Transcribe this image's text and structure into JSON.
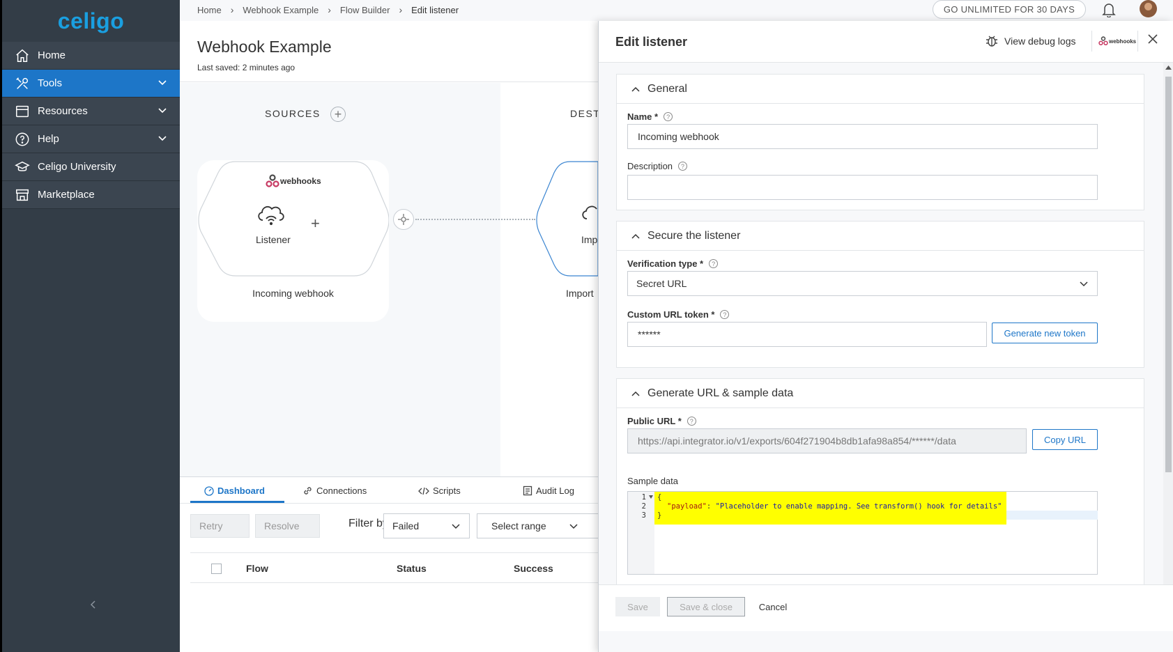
{
  "app": {
    "logo_text": "celigo"
  },
  "sidebar": {
    "items": [
      {
        "label": "Home",
        "icon": "home-icon",
        "active": false,
        "expandable": false
      },
      {
        "label": "Tools",
        "icon": "tools-icon",
        "active": true,
        "expandable": true
      },
      {
        "label": "Resources",
        "icon": "resources-icon",
        "active": false,
        "expandable": true
      },
      {
        "label": "Help",
        "icon": "help-icon",
        "active": false,
        "expandable": true
      },
      {
        "label": "Celigo University",
        "icon": "university-icon",
        "active": false,
        "expandable": false
      },
      {
        "label": "Marketplace",
        "icon": "marketplace-icon",
        "active": false,
        "expandable": false
      }
    ]
  },
  "topbar": {
    "breadcrumb": [
      "Home",
      "Webhook Example",
      "Flow Builder",
      "Edit listener"
    ],
    "promo_label": "GO UNLIMITED FOR 30 DAYS"
  },
  "flow": {
    "title": "Webhook Example",
    "last_saved": "Last saved: 2 minutes ago",
    "sources_label": "SOURCES",
    "destinations_label": "DEST",
    "source": {
      "brand": "webhooks",
      "type_label": "Listener",
      "name": "Incoming webhook"
    },
    "destination": {
      "type_label_partial": "Imp",
      "name_partial": "Import"
    }
  },
  "dashboard": {
    "tabs": [
      "Dashboard",
      "Connections",
      "Scripts",
      "Audit Log"
    ],
    "retry_label": "Retry",
    "resolve_label": "Resolve",
    "filter_label": "Filter by:",
    "filter_value": "Failed",
    "range_label": "Select range",
    "columns": [
      "Flow",
      "Status",
      "Success"
    ]
  },
  "drawer": {
    "title": "Edit listener",
    "debug_logs_label": "View debug logs",
    "brand_small": "webhooks",
    "general": {
      "title": "General",
      "name_label": "Name *",
      "name_value": "Incoming webhook",
      "description_label": "Description",
      "description_value": ""
    },
    "secure": {
      "title": "Secure the listener",
      "verification_label": "Verification type *",
      "verification_value": "Secret URL",
      "token_label": "Custom URL token *",
      "token_value": "******",
      "generate_label": "Generate new token"
    },
    "generate": {
      "title": "Generate URL & sample data",
      "public_url_label": "Public URL *",
      "public_url_value": "https://api.integrator.io/v1/exports/604f271904b8db1afa98a854/******/data",
      "copy_label": "Copy URL",
      "sample_label": "Sample data",
      "code_lines": [
        "1",
        "2",
        "3"
      ],
      "code_open": "{",
      "code_key": "\"payload\"",
      "code_sep": ": ",
      "code_value": "\"Placeholder to enable mapping. See transform() hook for details\"",
      "code_close": "}"
    },
    "footer": {
      "save_label": "Save",
      "save_close_label": "Save & close",
      "cancel_label": "Cancel"
    }
  },
  "colors": {
    "sidebar": "#333d47",
    "accent": "#1d76c8",
    "logo": "#1a9fe0",
    "highlight": "#ffff00"
  }
}
